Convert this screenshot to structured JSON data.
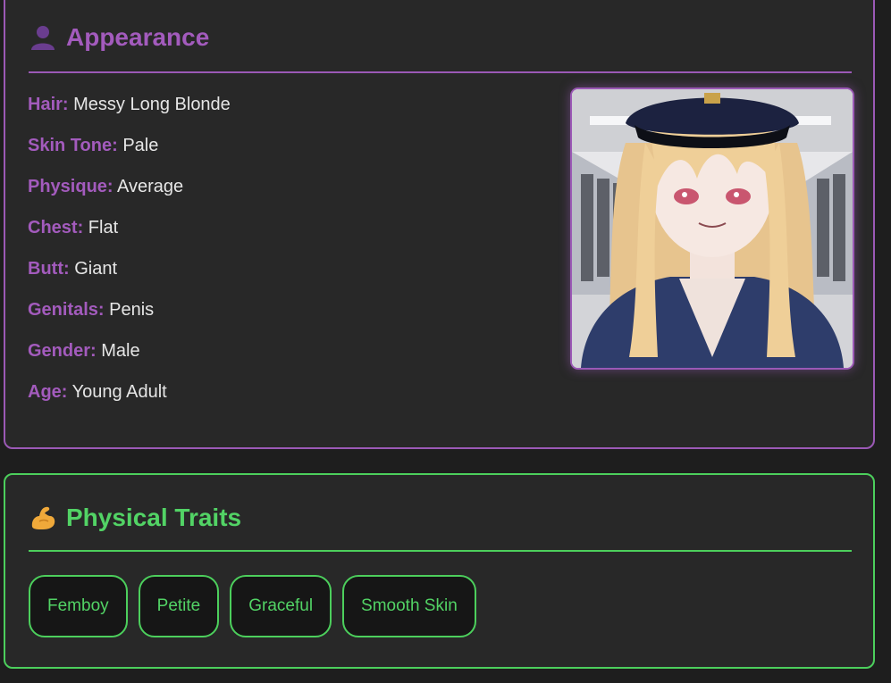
{
  "appearance": {
    "title": "Appearance",
    "icon": "person-icon",
    "accent": "#9b59b6",
    "attributes": [
      {
        "key": "Hair:",
        "value": "Messy Long Blonde"
      },
      {
        "key": "Skin Tone:",
        "value": "Pale"
      },
      {
        "key": "Physique:",
        "value": "Average"
      },
      {
        "key": "Chest:",
        "value": "Flat"
      },
      {
        "key": "Butt:",
        "value": "Giant"
      },
      {
        "key": "Genitals:",
        "value": "Penis"
      },
      {
        "key": "Gender:",
        "value": "Male"
      },
      {
        "key": "Age:",
        "value": "Young Adult"
      }
    ]
  },
  "traits": {
    "title": "Physical Traits",
    "icon": "flexed-biceps-icon",
    "accent": "#4ccf5c",
    "chips": [
      "Femboy",
      "Petite",
      "Graceful",
      "Smooth Skin"
    ]
  }
}
